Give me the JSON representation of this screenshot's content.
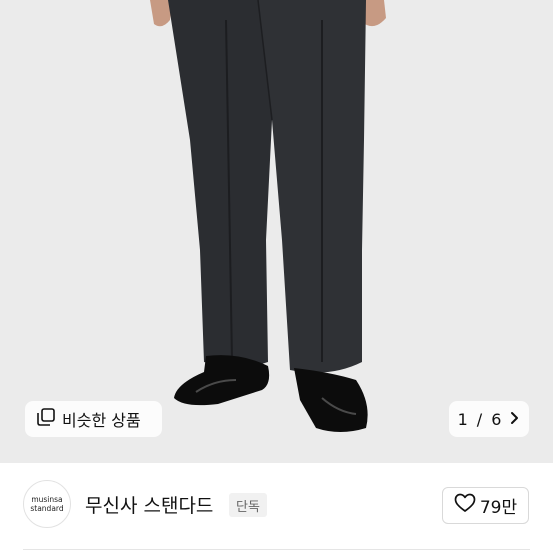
{
  "gallery": {
    "similar_label": "비슷한 상품",
    "counter_current": "1",
    "counter_separator": "/",
    "counter_total": "6"
  },
  "brand": {
    "logo_line1": "musinsa",
    "logo_line2": "standard",
    "name": "무신사 스탠다드",
    "tag": "단독",
    "likes": "79만"
  },
  "icons": {
    "similar": "stacked-squares-icon",
    "next": "chevron-right-icon",
    "like": "heart-outline-icon"
  },
  "colors": {
    "hero_background": "#ebebeb",
    "trousers": "#2b2d31",
    "shoes": "#0c0c0c"
  }
}
